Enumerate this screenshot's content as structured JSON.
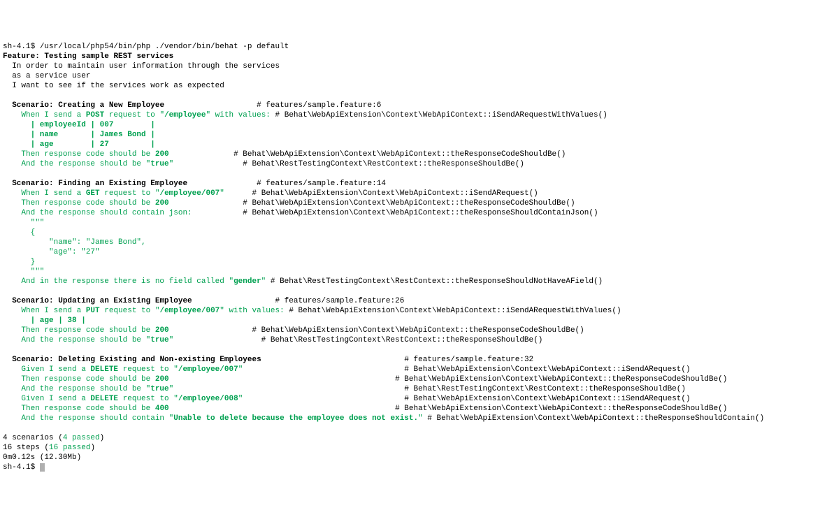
{
  "prompt1": "sh-4.1$ ",
  "command": "/usr/local/php54/bin/php ./vendor/bin/behat -p default",
  "feature_kw": "Feature: ",
  "feature_title": "Testing sample REST services",
  "feature_l1": "  In order to maintain user information through the services",
  "feature_l2": "  as a service user",
  "feature_l3": "  I want to see if the services work as expected",
  "scn_kw": "Scenario: ",
  "s1_title": "Creating a New Employee",
  "s1_pad": "                    ",
  "s1_loc": "# features/sample.feature:6",
  "s1_w1": "    When I send a ",
  "s1_post": "POST",
  "s1_w2": " request to \"",
  "s1_ep": "/employee",
  "s1_w3": "\" with values: ",
  "s1_ctx": "# Behat\\WebApiExtension\\Context\\WebApiContext::iSendARequestWithValues()",
  "s1_row1": "      | employeeId | 007        |",
  "s1_row2": "      | name       | James Bond |",
  "s1_row3": "      | age        | 27         |",
  "s1_then": "    Then response code should be ",
  "s1_200": "200",
  "s1_then_pad": "              ",
  "s1_then_ctx": "# Behat\\WebApiExtension\\Context\\WebApiContext::theResponseCodeShouldBe()",
  "s1_and": "    And the response should be \"",
  "s1_true": "true",
  "s1_and2": "\"",
  "s1_and_pad": "               ",
  "s1_and_ctx": "# Behat\\RestTestingContext\\RestContext::theResponseShouldBe()",
  "s2_title": "Finding an Existing Employee",
  "s2_pad": "               ",
  "s2_loc": "# features/sample.feature:14",
  "s2_w1": "    When I send a ",
  "s2_get": "GET",
  "s2_w2": " request to \"",
  "s2_ep": "/employee/007",
  "s2_w3": "\"",
  "s2_w_pad": "      ",
  "s2_ctx": "# Behat\\WebApiExtension\\Context\\WebApiContext::iSendARequest()",
  "s2_then": "    Then response code should be ",
  "s2_200": "200",
  "s2_then_pad": "                ",
  "s2_then_ctx": "# Behat\\WebApiExtension\\Context\\WebApiContext::theResponseCodeShouldBe()",
  "s2_and": "    And the response should contain json:",
  "s2_and_pad": "           ",
  "s2_and_ctx": "# Behat\\WebApiExtension\\Context\\WebApiContext::theResponseShouldContainJson()",
  "s2_j1": "      \"\"\"",
  "s2_j2": "      {",
  "s2_j3": "          \"name\": \"James Bond\",",
  "s2_j4": "          \"age\": \"27\"",
  "s2_j5": "      }",
  "s2_j6": "      \"\"\"",
  "s2_nf1": "    And in the response there is no field called \"",
  "s2_gender": "gender",
  "s2_nf2": "\" ",
  "s2_nf_ctx": "# Behat\\RestTestingContext\\RestContext::theResponseShouldNotHaveAField()",
  "s3_title": "Updating an Existing Employee",
  "s3_pad": "                  ",
  "s3_loc": "# features/sample.feature:26",
  "s3_w1": "    When I send a ",
  "s3_put": "PUT",
  "s3_w2": " request to \"",
  "s3_ep": "/employee/007",
  "s3_w3": "\" with values: ",
  "s3_ctx": "# Behat\\WebApiExtension\\Context\\WebApiContext::iSendARequestWithValues()",
  "s3_row1": "      | age | 38 |",
  "s3_then": "    Then response code should be ",
  "s3_200": "200",
  "s3_then_pad": "                  ",
  "s3_then_ctx": "# Behat\\WebApiExtension\\Context\\WebApiContext::theResponseCodeShouldBe()",
  "s3_and": "    And the response should be \"",
  "s3_true": "true",
  "s3_and2": "\"",
  "s3_and_pad": "                   ",
  "s3_and_ctx": "# Behat\\RestTestingContext\\RestContext::theResponseShouldBe()",
  "s4_title": "Deleting Existing and Non-existing Employees",
  "s4_pad": "                               ",
  "s4_loc": "# features/sample.feature:32",
  "s4_g1a": "    Given I send a ",
  "s4_del": "DELETE",
  "s4_g1b": " request to \"",
  "s4_ep1": "/employee/007",
  "s4_g1c": "\"",
  "s4_g1_pad": "                                   ",
  "s4_g1_ctx": "# Behat\\WebApiExtension\\Context\\WebApiContext::iSendARequest()",
  "s4_t1": "    Then response code should be ",
  "s4_200": "200",
  "s4_t1_pad": "                                                 ",
  "s4_t1_ctx": "# Behat\\WebApiExtension\\Context\\WebApiContext::theResponseCodeShouldBe()",
  "s4_a1": "    And the response should be \"",
  "s4_true": "true",
  "s4_a1b": "\"",
  "s4_a1_pad": "                                                  ",
  "s4_a1_ctx": "# Behat\\RestTestingContext\\RestContext::theResponseShouldBe()",
  "s4_g2a": "    Given I send a ",
  "s4_g2b": " request to \"",
  "s4_ep2": "/employee/008",
  "s4_g2c": "\"",
  "s4_g2_pad": "                                   ",
  "s4_g2_ctx": "# Behat\\WebApiExtension\\Context\\WebApiContext::iSendARequest()",
  "s4_t2": "    Then response code should be ",
  "s4_400": "400",
  "s4_t2_pad": "                                                 ",
  "s4_t2_ctx": "# Behat\\WebApiExtension\\Context\\WebApiContext::theResponseCodeShouldBe()",
  "s4_a2": "    And the response should contain \"",
  "s4_err": "Unable to delete because the employee does not exist.",
  "s4_a2b": "\" ",
  "s4_a2_ctx": "# Behat\\WebApiExtension\\Context\\WebApiContext::theResponseShouldContain()",
  "sum1a": "4 scenarios (",
  "sum1b": "4 passed",
  "sum1c": ")",
  "sum2a": "16 steps (",
  "sum2b": "16 passed",
  "sum2c": ")",
  "sum3": "0m0.12s (12.30Mb)",
  "prompt2": "sh-4.1$ "
}
